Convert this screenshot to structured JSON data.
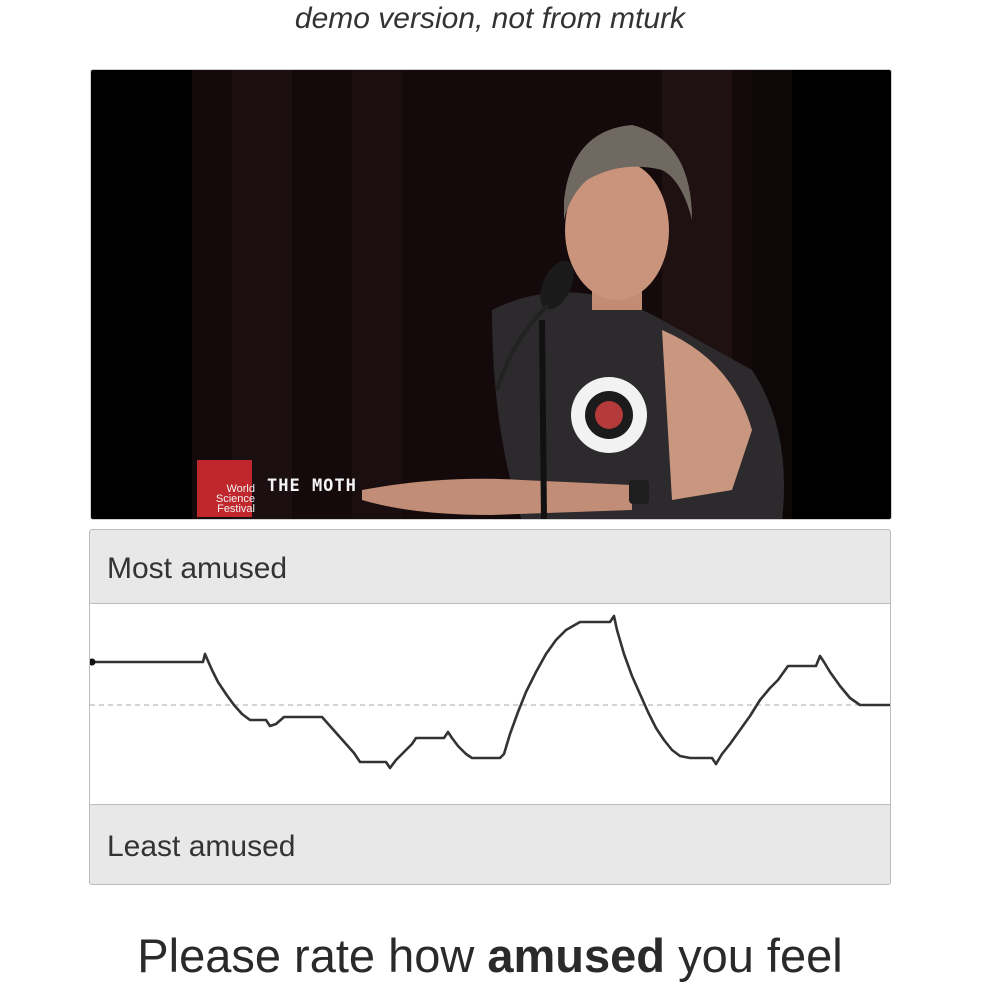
{
  "header": {
    "note": "demo version, not from mturk"
  },
  "video": {
    "logo_text": "World\nScience\nFestival",
    "overlay_title": "THE MOTH"
  },
  "rating": {
    "top_label": "Most amused",
    "bottom_label": "Least amused",
    "trace_color": "#333333",
    "midline_color": "#bbbbbb"
  },
  "prompt": {
    "before": "Please rate how ",
    "emphasis": "amused",
    "after": " you feel"
  }
}
